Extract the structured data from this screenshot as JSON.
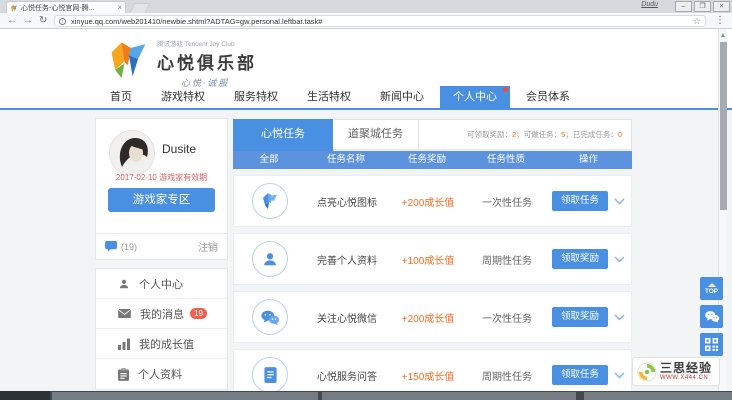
{
  "browser": {
    "tab_title": "心悦任务-心悦官网-腾...",
    "profile_name": "Dudu",
    "url": "xinyue.qq.com/web201410/newbie.shtml?ADTAG=gw.personal.leftbar.task#"
  },
  "header": {
    "logo": {
      "small": "腾讯游戏 Tencent Joy Club",
      "title": "心悦俱乐部",
      "slogan": "心悦·诚服"
    },
    "nav": [
      "首页",
      "游戏特权",
      "服务特权",
      "生活特权",
      "新闻中心",
      "个人中心",
      "会员体系"
    ]
  },
  "sidebar": {
    "username": "Dusite",
    "validity": "2017-02-10 游戏家有效期",
    "zone_button": "游戏家专区",
    "messages_count": "(19)",
    "logout": "注销",
    "menu": [
      {
        "label": "个人中心"
      },
      {
        "label": "我的消息",
        "badge": "19"
      },
      {
        "label": "我的成长值"
      },
      {
        "label": "个人资料"
      }
    ]
  },
  "main": {
    "tabs": [
      "心悦任务",
      "道聚城任务"
    ],
    "stats": {
      "label1": "可领取奖励：",
      "value1": "2",
      "sep1": "；",
      "label2": "可做任务：",
      "value2": "5",
      "sep2": "；",
      "label3": "已完成任务：",
      "value3": "0"
    },
    "columns": [
      "全部",
      "任务名称",
      "任务奖励",
      "任务性质",
      "操作"
    ],
    "tasks": [
      {
        "icon": "xinyue-gem-icon",
        "name": "点亮心悦图标",
        "reward": "+200成长值",
        "nature": "一次性任务",
        "action": "领取任务"
      },
      {
        "icon": "user-icon",
        "name": "完善个人资料",
        "reward": "+100成长值",
        "nature": "周期性任务",
        "action": "领取奖励"
      },
      {
        "icon": "wechat-icon",
        "name": "关注心悦微信",
        "reward": "+200成长值",
        "nature": "一次性任务",
        "action": "领取奖励"
      },
      {
        "icon": "document-icon",
        "name": "心悦服务问答",
        "reward": "+150成长值",
        "nature": "周期性任务",
        "action": "领取任务"
      }
    ]
  },
  "floating": {
    "top_label": "TOP"
  },
  "watermark": {
    "title": "三思经验",
    "url": "WWW.X444.CN"
  },
  "colors": {
    "accent": "#4a90e2",
    "table_header": "#5d92de",
    "reward_orange": "#ff6a1e",
    "badge_red": "#f0604d",
    "validity_red": "#dd6060"
  }
}
